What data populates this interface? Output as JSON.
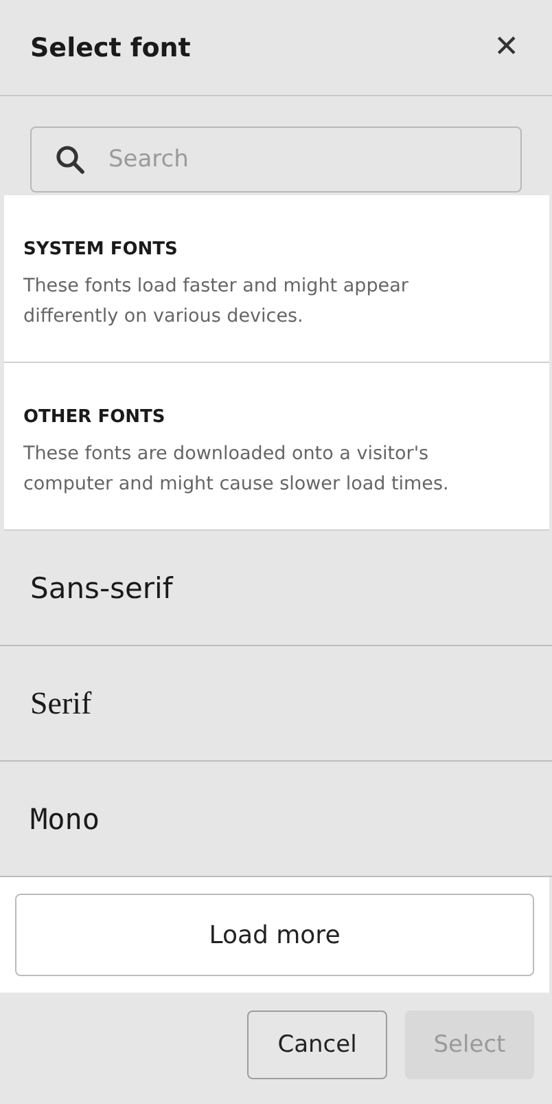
{
  "dialog": {
    "title": "Select font",
    "close_label": "✕"
  },
  "search": {
    "placeholder": "Search"
  },
  "categories": [
    {
      "heading": "SYSTEM FONTS",
      "description": "These fonts load faster and might appear differently on various devices."
    },
    {
      "heading": "OTHER FONTS",
      "description": "These fonts are downloaded onto a visitor's computer and might cause slower load times."
    }
  ],
  "fonts": [
    {
      "label": "Sans-serif",
      "kind": "sans",
      "selected": false
    },
    {
      "label": "Serif",
      "kind": "serif",
      "selected": false
    },
    {
      "label": "Mono",
      "kind": "mono",
      "selected": false
    }
  ],
  "load_more": "Load more",
  "buttons": [
    {
      "label": "Cancel",
      "disabled": false
    },
    {
      "label": "Select",
      "disabled": true
    }
  ]
}
